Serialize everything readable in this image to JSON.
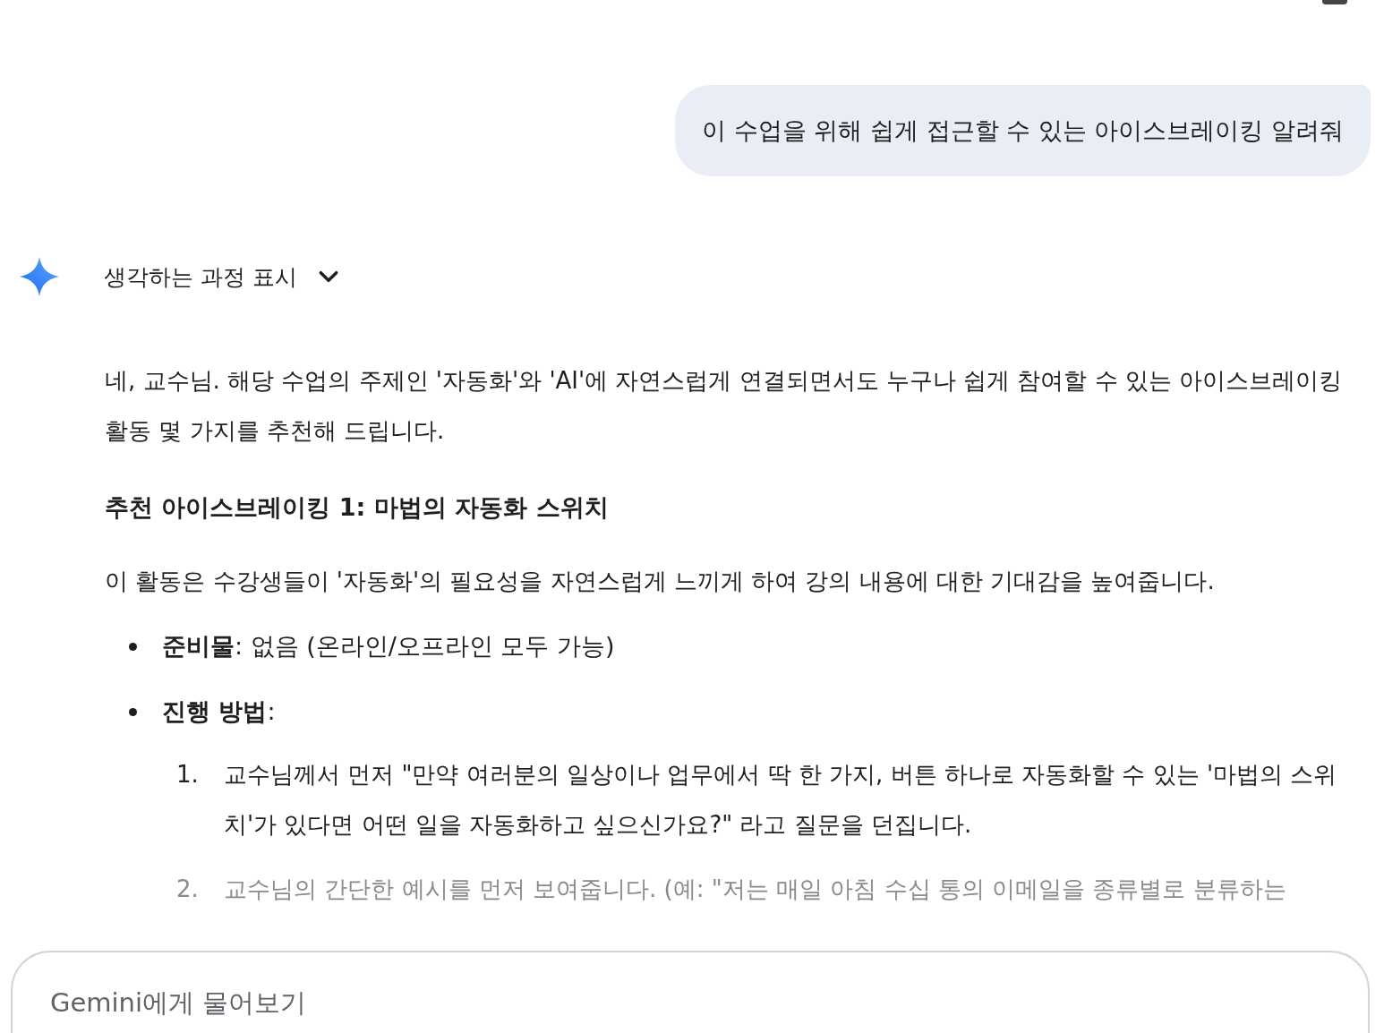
{
  "user_message": {
    "text": "이 수업을 위해 쉽게 접근할 수 있는 아이스브레이킹 알려줘"
  },
  "response": {
    "thinking_toggle": {
      "label": "생각하는 과정 표시",
      "expanded": false
    },
    "blocks": [
      {
        "kind": "paragraph",
        "text": "네, 교수님. 해당 수업의 주제인 '자동화'와 'AI'에 자연스럽게 연결되면서도 누구나 쉽게 참여할 수 있는 아이스브레이킹 활동 몇 가지를 추천해 드립니다."
      },
      {
        "kind": "heading",
        "text": "추천 아이스브레이킹 1: 마법의 자동화 스위치"
      },
      {
        "kind": "paragraph",
        "text": "이 활동은 수강생들이 '자동화'의 필요성을 자연스럽게 느끼게 하여 강의 내용에 대한 기대감을 높여줍니다."
      },
      {
        "kind": "bullets",
        "items": [
          {
            "text": "**준비물**: 없음 (온라인/오프라인 모두 가능)"
          },
          {
            "text": "**진행 방법**:",
            "children": [
              {
                "number": "1.",
                "text": "교수님께서 먼저 \"만약 여러분의 일상이나 업무에서 딱 한 가지, 버튼 하나로 자동화할 수 있는 '마법의 스위치'가 있다면 어떤 일을 자동화하고 싶으신가요?\" 라고 질문을 던집니다.",
                "faded": false
              },
              {
                "number": "2.",
                "text": "교수님의 간단한 예시를 먼저 보여줍니다. (예: \"저는 매일 아침 수십 통의 이메일을 종류별로 분류하는",
                "faded": true
              }
            ]
          }
        ]
      }
    ]
  },
  "input": {
    "placeholder": "Gemini에게 물어보기"
  }
}
